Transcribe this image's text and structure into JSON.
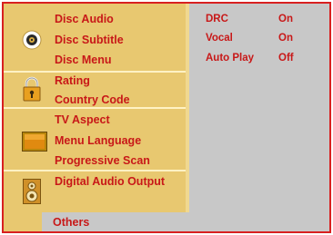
{
  "menu": {
    "groups": [
      {
        "icon": "disc-icon",
        "items": [
          "Disc Audio",
          "Disc Subtitle",
          "Disc Menu"
        ]
      },
      {
        "icon": "lock-icon",
        "items": [
          "Rating",
          "Country Code"
        ]
      },
      {
        "icon": "tv-icon",
        "items": [
          "TV Aspect",
          "Menu Language",
          "Progressive Scan"
        ]
      },
      {
        "icon": "speaker-icon",
        "items": [
          "Digital Audio Output"
        ]
      }
    ],
    "selected": "Others"
  },
  "settings": [
    {
      "label": "DRC",
      "value": "On"
    },
    {
      "label": "Vocal",
      "value": "On"
    },
    {
      "label": "Auto Play",
      "value": "Off"
    }
  ],
  "colors": {
    "border": "#d82020",
    "sidebar_bg": "#e8c870",
    "content_bg": "#c8c8c8",
    "text": "#c81818"
  }
}
